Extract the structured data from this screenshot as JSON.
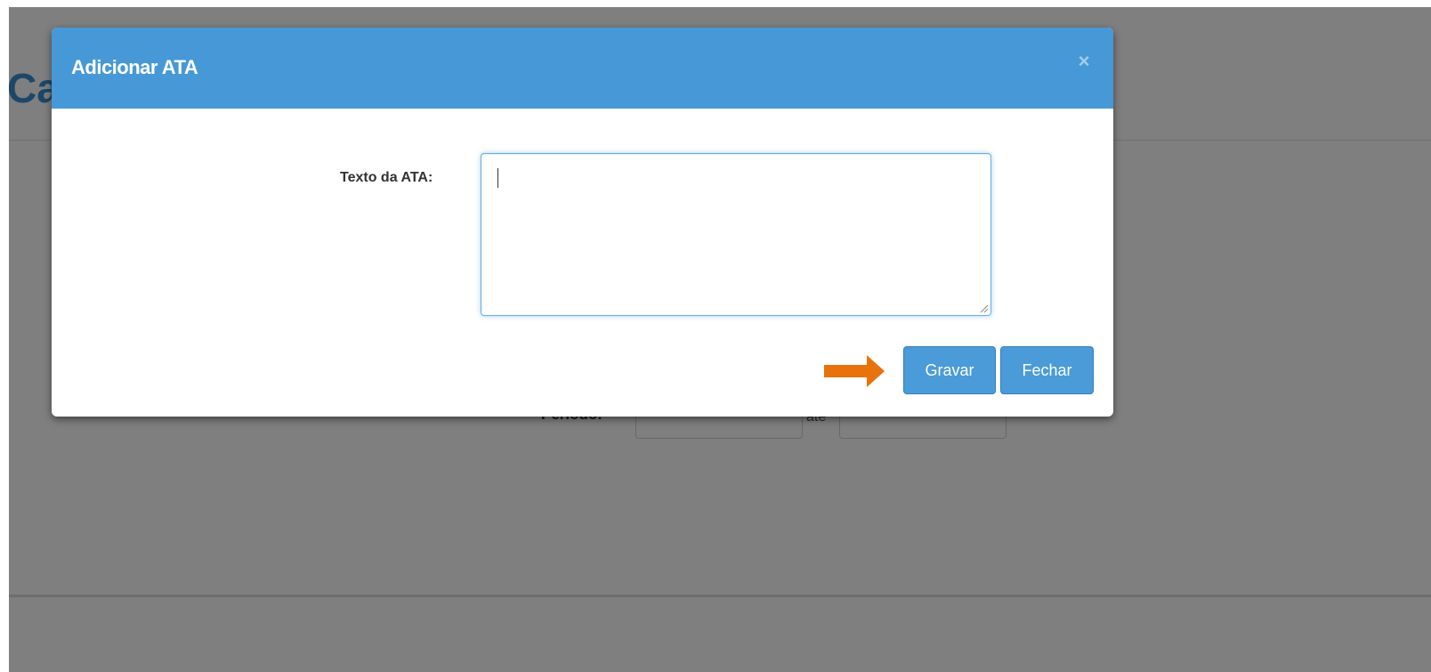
{
  "page": {
    "title_fragment": "Ca",
    "periodo_label": "Período:",
    "ate_label": "até"
  },
  "modal": {
    "title": "Adicionar ATA",
    "close_glyph": "×",
    "field_label": "Texto da ATA:",
    "textarea_value": "",
    "buttons": {
      "save": "Gravar",
      "close": "Fechar"
    }
  },
  "colors": {
    "header": "#4699d6",
    "button": "#4a9bd8",
    "arrow": "#e8720c",
    "title": "#3a8fd0"
  },
  "icons": {
    "close": "close-icon",
    "annotation": "arrow-right-icon"
  }
}
